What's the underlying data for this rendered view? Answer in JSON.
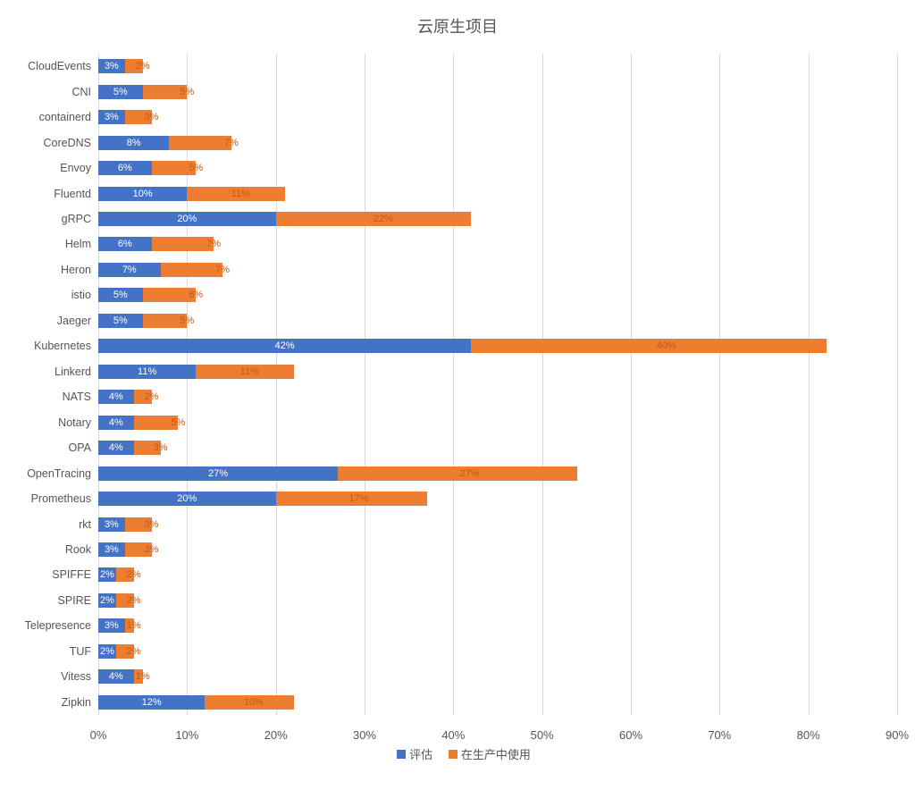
{
  "chart_data": {
    "type": "bar",
    "orientation": "horizontal",
    "stacked": true,
    "title": "云原生项目",
    "xlabel": "",
    "ylabel": "",
    "xlim": [
      0,
      90
    ],
    "x_ticks": [
      0,
      10,
      20,
      30,
      40,
      50,
      60,
      70,
      80,
      90
    ],
    "x_tick_format": "{v}%",
    "categories": [
      "CloudEvents",
      "CNI",
      "containerd",
      "CoreDNS",
      "Envoy",
      "Fluentd",
      "gRPC",
      "Helm",
      "Heron",
      "istio",
      "Jaeger",
      "Kubernetes",
      "Linkerd",
      "NATS",
      "Notary",
      "OPA",
      "OpenTracing",
      "Prometheus",
      "rkt",
      "Rook",
      "SPIFFE",
      "SPIRE",
      "Telepresence",
      "TUF",
      "Vitess",
      "Zipkin"
    ],
    "series": [
      {
        "name": "评估",
        "color": "#4472C4",
        "values": [
          3,
          5,
          3,
          8,
          6,
          10,
          20,
          6,
          7,
          5,
          5,
          42,
          11,
          4,
          4,
          4,
          27,
          20,
          3,
          3,
          2,
          2,
          3,
          2,
          4,
          12
        ]
      },
      {
        "name": "在生产中使用",
        "color": "#ED7D31",
        "values": [
          2,
          5,
          3,
          7,
          5,
          11,
          22,
          7,
          7,
          6,
          5,
          40,
          11,
          2,
          5,
          3,
          27,
          17,
          3,
          3,
          2,
          2,
          1,
          2,
          1,
          10
        ]
      }
    ],
    "legend_position": "bottom",
    "grid": {
      "y": false,
      "x": true
    }
  }
}
